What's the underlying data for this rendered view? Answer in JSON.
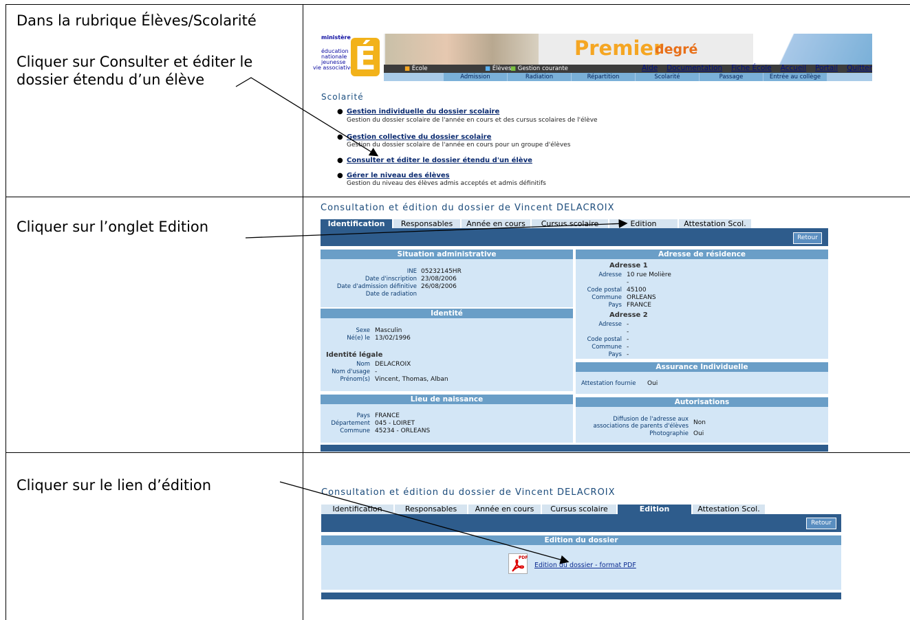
{
  "instructions": {
    "r1_line1": "Dans la rubrique Élèves/Scolarité",
    "r1_line2": "Cliquer sur Consulter et éditer le",
    "r1_line3": "dossier étendu d’un élève",
    "r2": "Cliquer sur l’onglet Edition",
    "r3": "Cliquer sur le lien d’édition"
  },
  "portal": {
    "ministry": [
      "ministère",
      "éducation",
      "nationale",
      "jeunesse",
      "vie associative"
    ],
    "brand_big": "Premier",
    "brand_small": "degré",
    "nav_links": [
      "Aide",
      "Documentation",
      "Fiche École",
      "Accueil",
      "Portail",
      "Quitter"
    ],
    "modules": [
      "École",
      "Élèves",
      "Gestion courante"
    ],
    "subnav": [
      "Admission",
      "Radiation",
      "Répartition",
      "Scolarité",
      "Passage",
      "Entrée au collège"
    ],
    "section_title": "Scolarité",
    "items": [
      {
        "link": "Gestion individuelle du dossier scolaire",
        "desc": "Gestion du dossier scolaire de l'année en cours et des cursus scolaires de l'élève"
      },
      {
        "link": "Gestion collective du dossier scolaire",
        "desc": "Gestion du dossier scolaire de l'année en cours pour un groupe d'élèves"
      },
      {
        "link": "Consulter et éditer le dossier étendu d'un élève",
        "desc": ""
      },
      {
        "link": "Gérer le niveau des élèves",
        "desc": "Gestion du niveau des élèves admis acceptés et admis définitifs"
      }
    ]
  },
  "consult": {
    "title": "Consultation et édition du dossier de Vincent DELACROIX",
    "tabs": [
      "Identification",
      "Responsables",
      "Année en cours",
      "Cursus scolaire",
      "Edition",
      "Attestation Scol."
    ],
    "retour": "Retour",
    "admin": {
      "header": "Situation administrative",
      "rows": [
        [
          "INE",
          "05232145HR"
        ],
        [
          "Date d'inscription",
          "23/08/2006"
        ],
        [
          "Date d'admission définitive",
          "26/08/2006"
        ],
        [
          "Date de radiation",
          ""
        ]
      ]
    },
    "identite": {
      "header": "Identité",
      "rows": [
        [
          "Sexe",
          "Masculin"
        ],
        [
          "Né(e) le",
          "13/02/1996"
        ]
      ],
      "legal_title": "Identité légale",
      "legal_rows": [
        [
          "Nom",
          "DELACROIX"
        ],
        [
          "Nom d'usage",
          "-"
        ],
        [
          "Prénom(s)",
          "Vincent, Thomas, Alban"
        ]
      ]
    },
    "lieu": {
      "header": "Lieu de naissance",
      "rows": [
        [
          "Pays",
          "FRANCE"
        ],
        [
          "Département",
          "045 - LOIRET"
        ],
        [
          "Commune",
          "45234 - ORLEANS"
        ]
      ]
    },
    "adresse": {
      "header": "Adresse de résidence",
      "a1_title": "Adresse 1",
      "a1_rows": [
        [
          "Adresse",
          "10 rue Molière"
        ],
        [
          "",
          "-"
        ],
        [
          "Code postal",
          "45100"
        ],
        [
          "Commune",
          "ORLEANS"
        ],
        [
          "Pays",
          "FRANCE"
        ]
      ],
      "a2_title": "Adresse 2",
      "a2_rows": [
        [
          "Adresse",
          "-"
        ],
        [
          "",
          "-"
        ],
        [
          "Code postal",
          "-"
        ],
        [
          "Commune",
          "-"
        ],
        [
          "Pays",
          "-"
        ]
      ]
    },
    "assurance": {
      "header": "Assurance Individuelle",
      "label": "Attestation fournie",
      "value": "Oui"
    },
    "autor": {
      "header": "Autorisations",
      "label1a": "Diffusion de l'adresse aux",
      "label1b": "associations de parents d'élèves",
      "value1": "Non",
      "label2": "Photographie",
      "value2": "Oui"
    }
  },
  "edition": {
    "title": "Consultation et édition du dossier de Vincent DELACROIX",
    "tabs": [
      "Identification",
      "Responsables",
      "Année en cours",
      "Cursus scolaire",
      "Edition",
      "Attestation Scol."
    ],
    "retour": "Retour",
    "header": "Edition du dossier",
    "pdf_tag": "PDF",
    "link": "Edition du dossier - format PDF"
  },
  "colors": {
    "accent": "#2e5c8c",
    "panel": "#d3e6f6",
    "panel_header": "#6a9ec7"
  }
}
